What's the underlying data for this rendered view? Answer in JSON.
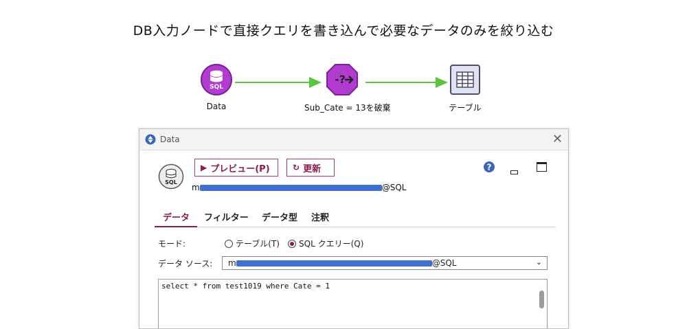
{
  "page": {
    "title": "DB入力ノードで直接クエリを書き込んで必要なデータのみを絞り込む"
  },
  "flow": {
    "nodes": [
      {
        "label": "Data",
        "icon": "database-sql-icon"
      },
      {
        "label": "Sub_Cate = 13を破棄",
        "icon": "select-filter-icon"
      },
      {
        "label": "テーブル",
        "icon": "table-icon"
      }
    ],
    "colors": {
      "node_purple": "#b23ccf",
      "link_green": "#5cc43c",
      "table_border": "#4b4b6b"
    }
  },
  "dialog": {
    "title": "Data",
    "close_glyph": "✕",
    "sql_badge": "SQL",
    "buttons": {
      "preview": "プレビュー(P)",
      "refresh": "更新"
    },
    "connection": {
      "prefix": "m",
      "suffix": "@SQL"
    },
    "tabs": [
      {
        "label": "データ",
        "active": true
      },
      {
        "label": "フィルター",
        "active": false
      },
      {
        "label": "データ型",
        "active": false
      },
      {
        "label": "注釈",
        "active": false
      }
    ],
    "mode": {
      "label": "モード:",
      "options": [
        {
          "label": "テーブル(T)",
          "selected": false
        },
        {
          "label": "SQL クエリー(Q)",
          "selected": true
        }
      ]
    },
    "datasource": {
      "label": "データ ソース:",
      "prefix": "m",
      "suffix": "@SQL"
    },
    "query": "select * from test1019 where Cate = 1",
    "accent_color": "#8a1c4f",
    "redaction_color": "#3f6fd0"
  }
}
